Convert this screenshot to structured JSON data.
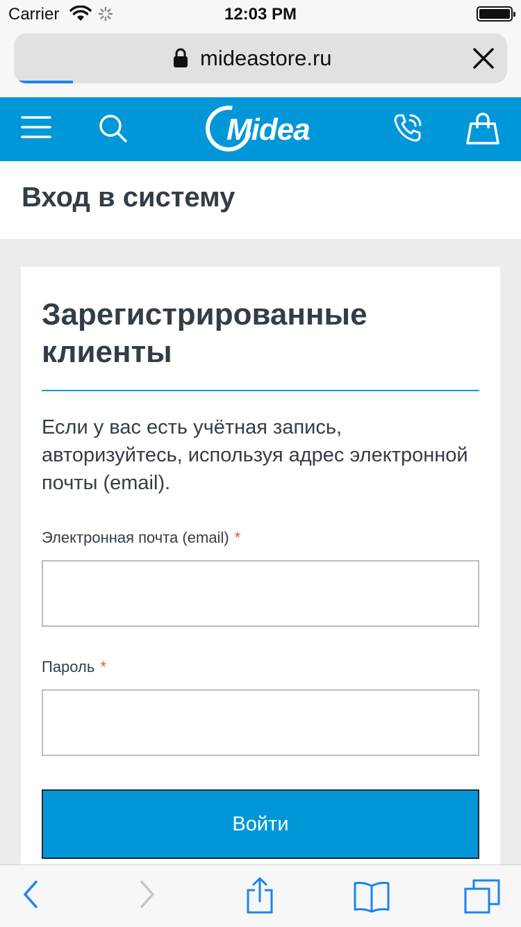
{
  "status_bar": {
    "carrier": "Carrier",
    "time": "12:03 PM"
  },
  "address_bar": {
    "url": "mideastore.ru",
    "load_progress": 0.12
  },
  "header": {
    "logo_text": "Midea",
    "brand_color": "#0097d8"
  },
  "page": {
    "title": "Вход в систему"
  },
  "login": {
    "heading": "Зарегистрированные клиенты",
    "intro": "Если у вас есть учётная запись, авторизуйтесь, используя адрес электронной почты (email).",
    "email_label": "Электронная почта (email)",
    "email_value": "",
    "password_label": "Пароль",
    "password_value": "",
    "required_mark": "*",
    "submit_label": "Войти"
  },
  "toolbar": {
    "icons": [
      "back-icon",
      "forward-icon",
      "share-icon",
      "bookmarks-icon",
      "tabs-icon"
    ]
  }
}
